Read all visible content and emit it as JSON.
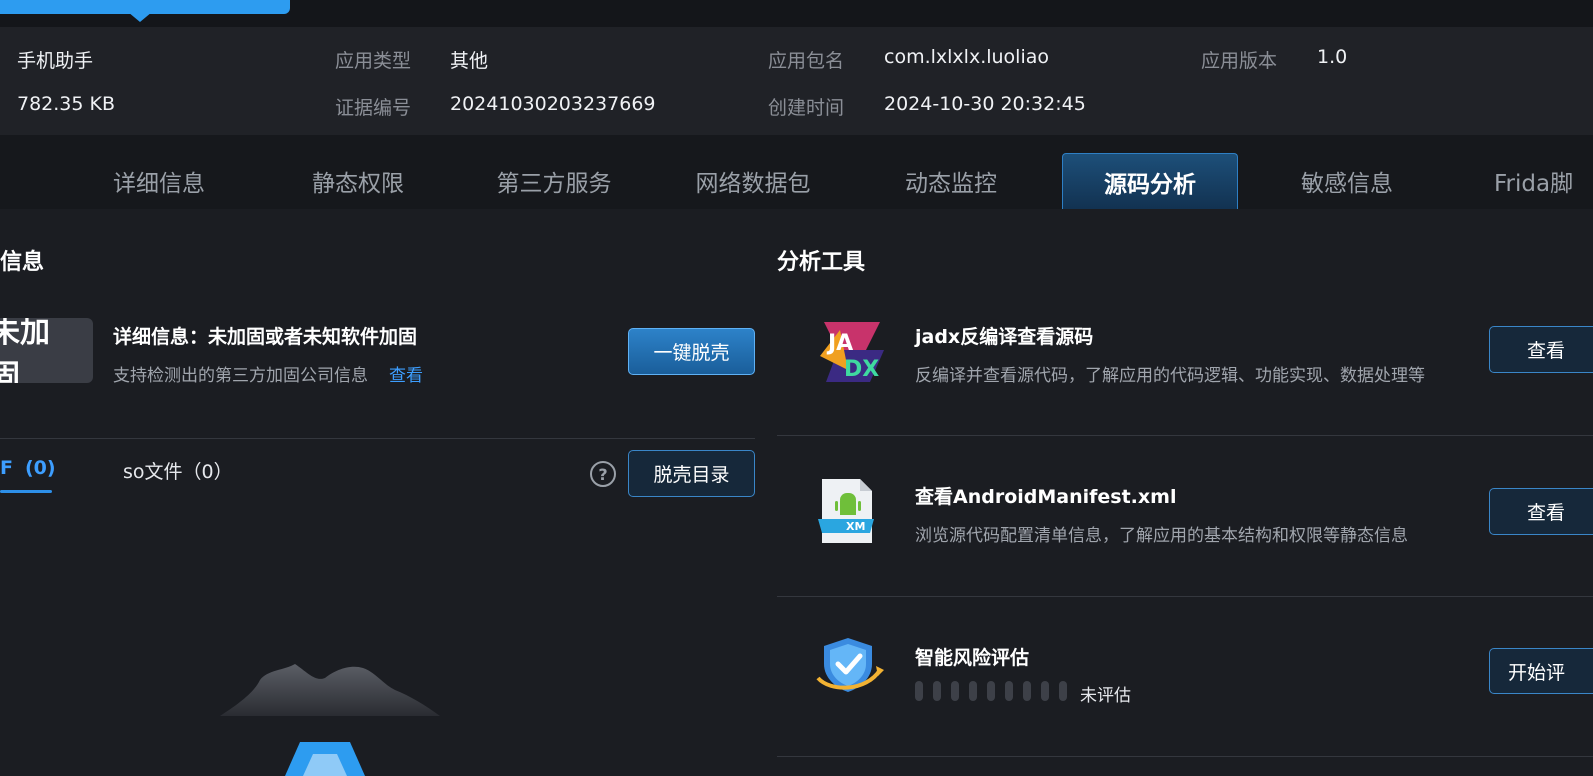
{
  "header": {
    "app_name": "手机助手",
    "app_size": "782.35 KB",
    "type_label": "应用类型",
    "type_value": "其他",
    "cert_label": "证据编号",
    "cert_value": "20241030203237669",
    "package_label": "应用包名",
    "package_value": "com.lxlxlx.luoliao",
    "created_label": "创建时间",
    "created_value": "2024-10-30 20:32:45",
    "version_label": "应用版本",
    "version_value": "1.0"
  },
  "tabs": [
    {
      "label": "详细信息"
    },
    {
      "label": "静态权限"
    },
    {
      "label": "第三方服务"
    },
    {
      "label": "网络数据包"
    },
    {
      "label": "动态监控"
    },
    {
      "label": "源码分析"
    },
    {
      "label": "敏感信息"
    },
    {
      "label": "Frida脚"
    }
  ],
  "active_tab": "源码分析",
  "protection": {
    "section_title": "信息",
    "badge": "未加固",
    "detail": "详细信息：未加固或者未知软件加固",
    "support_text": "支持检测出的第三方加固公司信息",
    "view_link": "查看",
    "unpack_button": "一键脱壳",
    "file_tab_active": "(0)",
    "file_tab_active_mark": "F",
    "file_tab_so": "so文件（0）",
    "help_glyph": "?",
    "unpack_dir_button": "脱壳目录"
  },
  "tools": {
    "section_title": "分析工具",
    "items": [
      {
        "title": "jadx反编译查看源码",
        "desc": "反编译并查看源代码，了解应用的代码逻辑、功能实现、数据处理等",
        "button": "查看",
        "icon": "jadx-icon",
        "icon_text_top": "JA",
        "icon_text_bottom": "DX"
      },
      {
        "title": "查看AndroidManifest.xml",
        "desc": "浏览源代码配置清单信息，了解应用的基本结构和权限等静态信息",
        "button": "查看",
        "icon": "xml-file-icon",
        "icon_text": "XM"
      },
      {
        "title": "智能风险评估",
        "desc": "",
        "button": "开始评",
        "icon": "shield-check-icon",
        "status": "未评估"
      }
    ]
  },
  "colors": {
    "accent": "#2d9cf0",
    "link": "#3d9eff",
    "background": "#1b1d22",
    "panel": "#202227"
  }
}
